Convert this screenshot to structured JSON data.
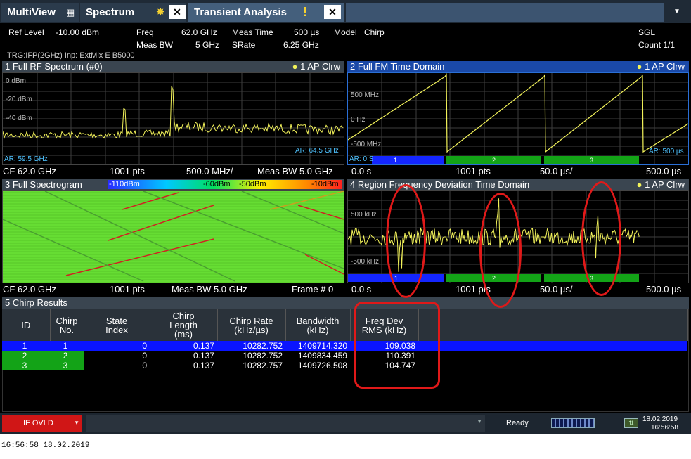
{
  "tabs": [
    {
      "label": "MultiView"
    },
    {
      "label": "Spectrum"
    },
    {
      "label": "Transient Analysis"
    }
  ],
  "params": {
    "ref_level_label": "Ref Level",
    "ref_level_value": "-10.00 dBm",
    "freq_label": "Freq",
    "freq_value": "62.0 GHz",
    "meas_bw_label": "Meas BW",
    "meas_bw_value": "5 GHz",
    "meas_time_label": "Meas Time",
    "meas_time_value": "500 µs",
    "srate_label": "SRate",
    "srate_value": "6.25 GHz",
    "model_label": "Model",
    "model_value": "Chirp",
    "sgl": "SGL",
    "count": "Count 1/1",
    "trigger": "TRG:IFP(2GHz) Inp: ExtMix E B5000"
  },
  "w1": {
    "title": "1 Full RF Spectrum (#0)",
    "trace": "1 AP Clrw",
    "y_labels": [
      "0 dBm",
      "-20 dBm",
      "-40 dBm"
    ],
    "ar_left": "AR: 59.5 GHz",
    "ar_right": "AR: 64.5 GHz",
    "footer": [
      "CF 62.0 GHz",
      "1001 pts",
      "500.0 MHz/",
      "Meas BW 5.0 GHz"
    ]
  },
  "w2": {
    "title": "2 Full FM Time Domain",
    "trace": "1 AP Clrw",
    "y_labels": [
      "500 MHz",
      "0 Hz",
      "-500 MHz"
    ],
    "ar_left": "AR: 0 S",
    "ar_right": "AR: 500 µs",
    "segments": [
      "1",
      "2",
      "3"
    ],
    "footer": [
      "0.0 s",
      "1001 pts",
      "50.0 µs/",
      "500.0 µs"
    ]
  },
  "w3": {
    "title": "3 Full Spectrogram",
    "scale": [
      "-110dBm",
      "-60dBm",
      "-50dBm",
      "-10dBm"
    ],
    "footer": [
      "CF 62.0 GHz",
      "1001 pts",
      "Meas BW 5.0 GHz",
      "Frame # 0"
    ]
  },
  "w4": {
    "title": "4 Region Frequency Deviation Time Domain",
    "trace": "1 AP Clrw",
    "y_labels": [
      "500 kHz",
      "-500 kHz"
    ],
    "segments": [
      "1",
      "2",
      "3"
    ],
    "footer": [
      "0.0 s",
      "1001 pts",
      "50.0 µs/",
      "500.0 µs"
    ]
  },
  "w5": {
    "title": "5 Chirp Results",
    "headers": [
      "ID",
      "Chirp No.",
      "State Index",
      "Chirp Length (ms)",
      "Chirp Rate (kHz/µs)",
      "Bandwidth (kHz)",
      "Freq Dev RMS (kHz)"
    ],
    "rows": [
      [
        "1",
        "1",
        "0",
        "0.137",
        "10282.752",
        "1409714.320",
        "109.038"
      ],
      [
        "2",
        "2",
        "0",
        "0.137",
        "10282.752",
        "1409834.459",
        "110.391"
      ],
      [
        "3",
        "3",
        "0",
        "0.137",
        "10282.757",
        "1409726.508",
        "104.747"
      ]
    ]
  },
  "status": {
    "if_ovld": "IF OVLD",
    "ready": "Ready",
    "date": "18.02.2019",
    "time": "16:56:58"
  },
  "caption": "16:56:58  18.02.2019",
  "colors": {
    "trace": "#f2f25a",
    "selected_row": "#0a14ff",
    "segment_blue": "#1426ff",
    "segment_green": "#13a317",
    "spectrogram_bg": "#66dd33",
    "annotation": "#e01919",
    "ovld": "#d01616"
  }
}
